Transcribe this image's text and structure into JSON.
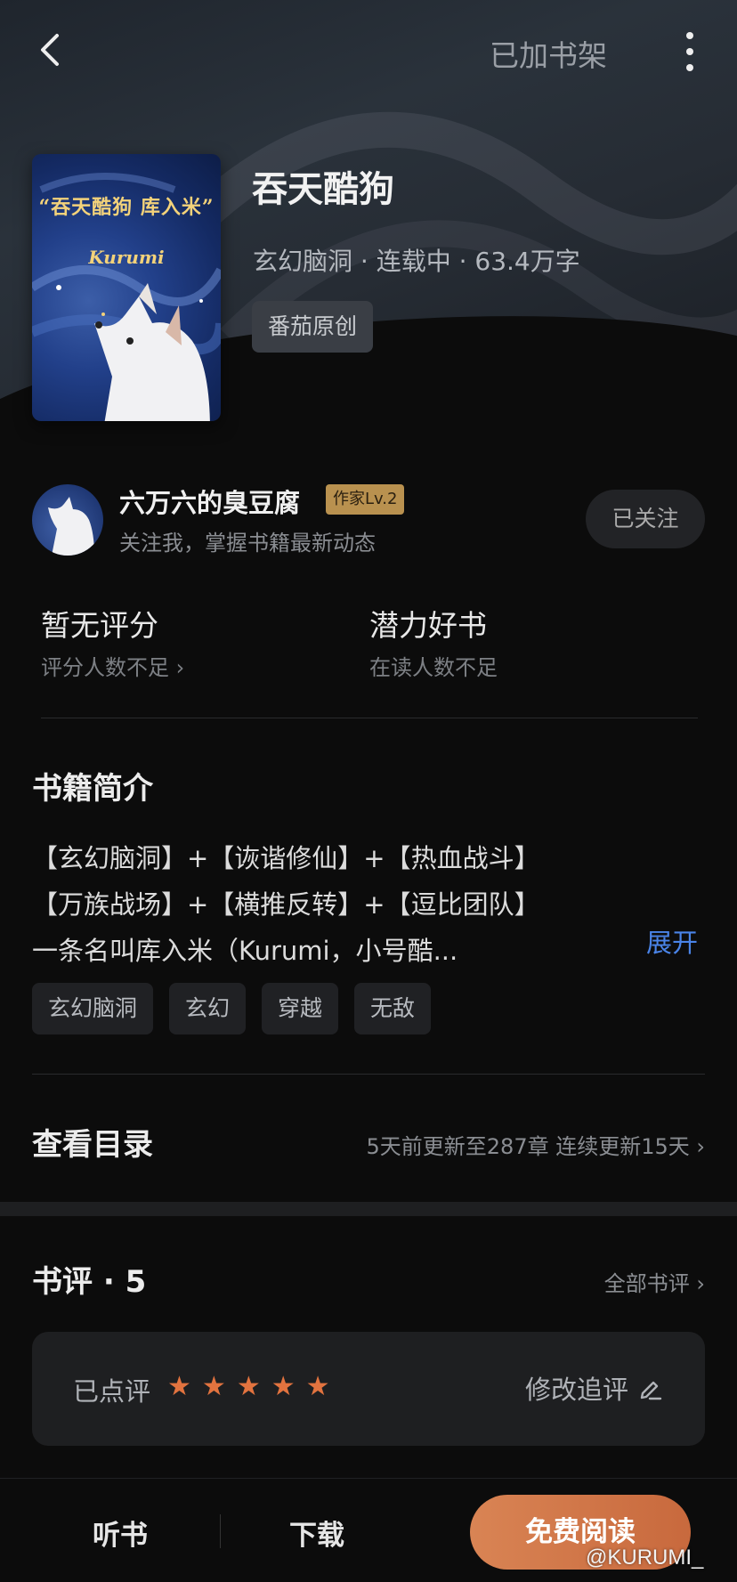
{
  "header": {
    "shelf_label": "已加书架"
  },
  "book": {
    "title": "吞天酷狗",
    "meta": "玄幻脑洞 · 连载中 · 63.4万字",
    "tag": "番茄原创",
    "cover_title": "“吞天酷狗 库入米”",
    "cover_author": "Kurumi"
  },
  "author": {
    "name": "六万六的臭豆腐",
    "level": "作家Lv.2",
    "subtitle": "关注我，掌握书籍最新动态",
    "follow_label": "已关注"
  },
  "stats": [
    {
      "main": "暂无评分",
      "sub": "评分人数不足 ›"
    },
    {
      "main": "潜力好书",
      "sub": "在读人数不足"
    }
  ],
  "intro": {
    "title": "书籍简介",
    "lines": [
      "【玄幻脑洞】+【诙谐修仙】+【热血战斗】",
      "【万族战场】+【横推反转】+【逗比团队】",
      "一条名叫库入米（Kurumi，小号酷..."
    ],
    "expand_label": "展开"
  },
  "tags": [
    "玄幻脑洞",
    "玄幻",
    "穿越",
    "无敌"
  ],
  "toc": {
    "title": "查看目录",
    "info": "5天前更新至287章 连续更新15天 ›"
  },
  "reviews": {
    "title": "书评 · 5",
    "all_label": "全部书评 ›",
    "rated_label": "已点评",
    "rating": 5,
    "edit_label": "修改追评"
  },
  "bottom": {
    "listen_label": "听书",
    "download_label": "下载",
    "read_label": "免费阅读"
  },
  "watermark": "@KURUMI_",
  "colors": {
    "accent_star": "#e2733f",
    "link_blue": "#4a84e8",
    "read_button": "#d98454",
    "level_badge": "#b9914f"
  }
}
